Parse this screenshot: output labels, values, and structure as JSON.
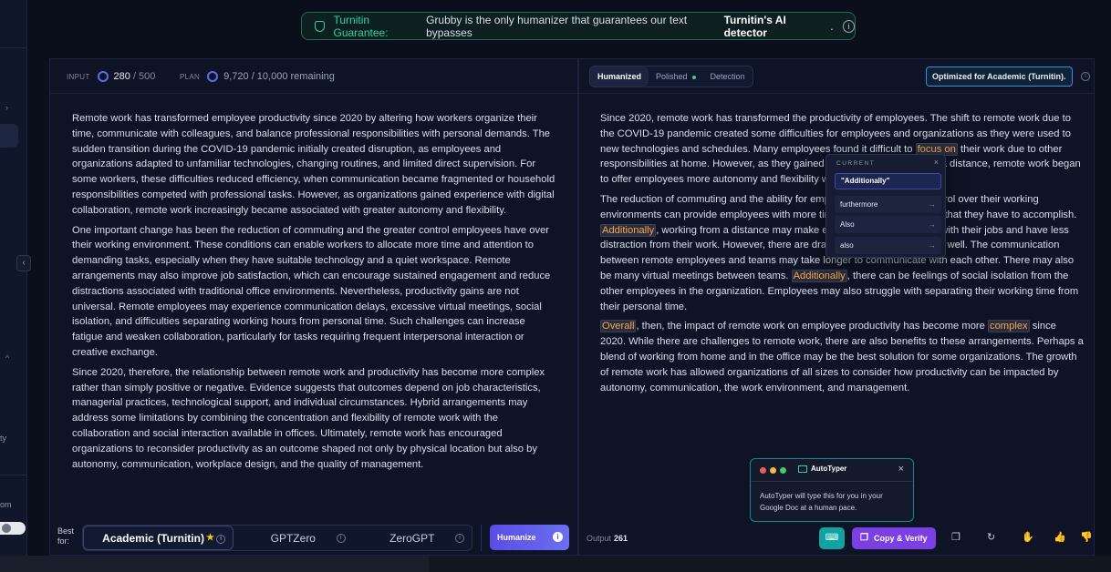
{
  "banner": {
    "label": "Turnitin Guarantee:",
    "text": "Grubby is the only humanizer that guarantees our text bypasses",
    "bold": "Turnitin's AI detector",
    "end": ".",
    "info": "i"
  },
  "sidebar": {
    "partial_text_1": "ty",
    "partial_text_2": "om",
    "collapse": "‹"
  },
  "input": {
    "label": "INPUT",
    "count": "280",
    "max": "/ 500",
    "plan_label": "PLAN",
    "plan_value": "9,720 / 10,000 remaining"
  },
  "output_tabs": [
    {
      "label": "Humanized"
    },
    {
      "label": "Polished"
    },
    {
      "label": "Detection"
    }
  ],
  "optimized_badge": "Optimized for Academic (Turnitin).",
  "input_text": [
    "Remote work has transformed employee productivity since 2020 by altering how workers organize their time, communicate with colleagues, and balance professional responsibilities with personal demands. The sudden transition during the COVID-19 pandemic initially created disruption, as employees and organizations adapted to unfamiliar technologies, changing routines, and limited direct supervision. For some workers, these difficulties reduced efficiency, when communication became fragmented or household responsibilities competed with professional tasks. However, as organizations gained experience with digital collaboration, remote work increasingly became associated with greater autonomy and flexibility.",
    "One important change has been the reduction of commuting and the greater control employees have over their working environment. These conditions can enable workers to allocate more time and attention to demanding tasks, especially when they have suitable technology and a quiet workspace. Remote arrangements may also improve job satisfaction, which can encourage sustained engagement and reduce distractions associated with traditional office environments. Nevertheless, productivity gains are not universal. Remote employees may experience communication delays, excessive virtual meetings, social isolation, and difficulties separating working hours from personal time. Such challenges can increase fatigue and weaken collaboration, particularly for tasks requiring frequent interpersonal interaction or creative exchange.",
    "Since 2020, therefore, the relationship between remote work and productivity has become more complex rather than simply positive or negative. Evidence suggests that outcomes depend on job characteristics, managerial practices, technological support, and individual circumstances. Hybrid arrangements may address some limitations by combining the concentration and flexibility of remote work with the collaboration and social interaction available in offices. Ultimately, remote work has encouraged organizations to reconsider productivity as an outcome shaped not only by physical location but also by autonomy, communication, workplace design, and the quality of management."
  ],
  "output_text": {
    "p1_a": "Since 2020, remote work has transformed the productivity of employees. The shift to remote work due to the COVID-19 pandemic created some difficulties for employees and organizations as they were used to new technologies and schedules. Many employees found it difficult to ",
    "p1_hl": "focus on",
    "p1_b": " their work due to other responsibilities at home. However, as they gained experience working from a distance, remote work began to offer employees more autonomy and flexibility with time.",
    "p2_a": "The reduction of commuting and the ability for employees to have more control over their working environments can provide employees with more time and attention for tasks that they have to accomplish. ",
    "p2_hl1": "Additionally",
    "p2_b": ", working from a distance may make employees more satisfied with their jobs and have less distraction from their work. However, there are drawbacks to remote work as well. The communication between remote employees and teams may take longer to communicate with each other. There may also be many virtual meetings between teams. ",
    "p2_hl2": "Additionally",
    "p2_c": ", there can be feelings of social isolation from the other employees in the organization. Employees may also struggle with separating their working time from their personal time.",
    "p3_hl1": "Overall",
    "p3_a": ", then, the impact of remote work on employee productivity has become more ",
    "p3_hl2": "complex",
    "p3_b": " since 2020. While there are challenges to remote work, there are also benefits to these arrangements. Perhaps a blend of working from home and in the office may be the best solution for some organizations. The growth of remote work has allowed organizations of all sizes to consider how productivity can be impacted by autonomy, communication, the work environment, and management."
  },
  "synonym_popup": {
    "current_label": "CURRENT",
    "current": "\"Additionally\"",
    "options": [
      "furthermore",
      "Also",
      "also"
    ],
    "arrow": "→",
    "close": "×"
  },
  "best_for": {
    "label_1": "Best",
    "label_2": "for:",
    "options": [
      {
        "label": "Academic (Turnitin)",
        "star": "★"
      },
      {
        "label": "GPTZero"
      },
      {
        "label": "ZeroGPT"
      }
    ],
    "info": "i"
  },
  "humanize_button": "Humanize",
  "output": {
    "label": "Output",
    "count": "261"
  },
  "copy_verify": "Copy & Verify",
  "autotyper": {
    "title": "AutoTyper",
    "close": "×",
    "body": "AutoTyper will type this for you in your Google Doc at a human pace."
  },
  "colors": {
    "accent_purple": "#7b3fe4",
    "accent_teal": "#0fa3a3",
    "guarantee_green": "#2dd4a0",
    "highlight_orange": "#f2a55a"
  }
}
